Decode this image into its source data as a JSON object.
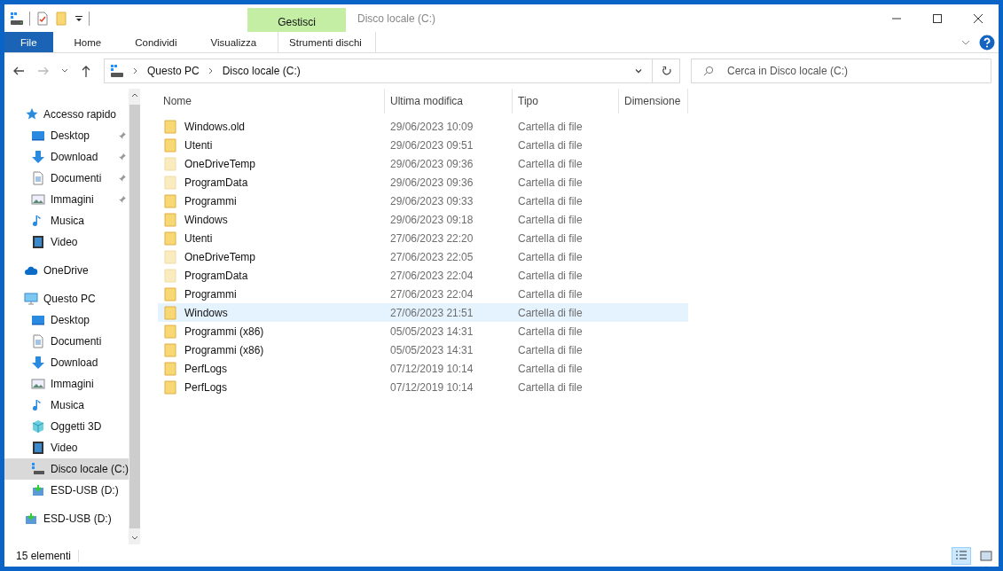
{
  "window": {
    "title": "Disco locale (C:)",
    "context_tab": "Gestisci"
  },
  "ribbon_tabs": [
    {
      "label": "File",
      "kind": "file",
      "selected": false
    },
    {
      "label": "Home",
      "kind": "tab",
      "selected": false
    },
    {
      "label": "Condividi",
      "kind": "tab",
      "selected": false
    },
    {
      "label": "Visualizza",
      "kind": "tab",
      "selected": false
    },
    {
      "label": "Strumenti dischi",
      "kind": "context",
      "selected": false
    }
  ],
  "address": {
    "path": [
      "Questo PC",
      "Disco locale (C:)"
    ]
  },
  "search": {
    "placeholder": "Cerca in Disco locale (C:)"
  },
  "sidebar": {
    "items": [
      {
        "label": "Accesso rapido",
        "kind": "star",
        "selected": false,
        "children": [
          {
            "label": "Desktop",
            "kind": "desktop",
            "pinned": true,
            "selected": false
          },
          {
            "label": "Download",
            "kind": "download",
            "pinned": true,
            "selected": false
          },
          {
            "label": "Documenti",
            "kind": "document",
            "pinned": true,
            "selected": false
          },
          {
            "label": "Immagini",
            "kind": "image",
            "pinned": true,
            "selected": false
          },
          {
            "label": "Musica",
            "kind": "music",
            "pinned": false,
            "selected": false
          },
          {
            "label": "Video",
            "kind": "video",
            "pinned": false,
            "selected": false
          }
        ]
      },
      {
        "label": "OneDrive",
        "kind": "cloud",
        "selected": false
      },
      {
        "label": "Questo PC",
        "kind": "pc",
        "selected": false,
        "children": [
          {
            "label": "Desktop",
            "kind": "desktop",
            "pinned": false,
            "selected": false
          },
          {
            "label": "Documenti",
            "kind": "document",
            "pinned": false,
            "selected": false
          },
          {
            "label": "Download",
            "kind": "download",
            "pinned": false,
            "selected": false
          },
          {
            "label": "Immagini",
            "kind": "image",
            "pinned": false,
            "selected": false
          },
          {
            "label": "Musica",
            "kind": "music",
            "pinned": false,
            "selected": false
          },
          {
            "label": "Oggetti 3D",
            "kind": "cube",
            "pinned": false,
            "selected": false
          },
          {
            "label": "Video",
            "kind": "video",
            "pinned": false,
            "selected": false
          },
          {
            "label": "Disco locale (C:)",
            "kind": "drive",
            "pinned": false,
            "selected": true
          },
          {
            "label": "ESD-USB (D:)",
            "kind": "usb",
            "pinned": false,
            "selected": false
          }
        ]
      },
      {
        "label": "ESD-USB (D:)",
        "kind": "usb",
        "selected": false
      }
    ]
  },
  "table": {
    "columns": [
      "Nome",
      "Ultima modifica",
      "Tipo",
      "Dimensione"
    ],
    "rows": [
      {
        "name": "Windows.old",
        "modified": "29/06/2023 10:09",
        "type": "Cartella di file",
        "hidden": false,
        "selected": false
      },
      {
        "name": "Utenti",
        "modified": "29/06/2023 09:51",
        "type": "Cartella di file",
        "hidden": false,
        "selected": false
      },
      {
        "name": "OneDriveTemp",
        "modified": "29/06/2023 09:36",
        "type": "Cartella di file",
        "hidden": true,
        "selected": false
      },
      {
        "name": "ProgramData",
        "modified": "29/06/2023 09:36",
        "type": "Cartella di file",
        "hidden": true,
        "selected": false
      },
      {
        "name": "Programmi",
        "modified": "29/06/2023 09:33",
        "type": "Cartella di file",
        "hidden": false,
        "selected": false
      },
      {
        "name": "Windows",
        "modified": "29/06/2023 09:18",
        "type": "Cartella di file",
        "hidden": false,
        "selected": false
      },
      {
        "name": "Utenti",
        "modified": "27/06/2023 22:20",
        "type": "Cartella di file",
        "hidden": false,
        "selected": false
      },
      {
        "name": "OneDriveTemp",
        "modified": "27/06/2023 22:05",
        "type": "Cartella di file",
        "hidden": true,
        "selected": false
      },
      {
        "name": "ProgramData",
        "modified": "27/06/2023 22:04",
        "type": "Cartella di file",
        "hidden": true,
        "selected": false
      },
      {
        "name": "Programmi",
        "modified": "27/06/2023 22:04",
        "type": "Cartella di file",
        "hidden": false,
        "selected": false
      },
      {
        "name": "Windows",
        "modified": "27/06/2023 21:51",
        "type": "Cartella di file",
        "hidden": false,
        "selected": true
      },
      {
        "name": "Programmi (x86)",
        "modified": "05/05/2023 14:31",
        "type": "Cartella di file",
        "hidden": false,
        "selected": false
      },
      {
        "name": "Programmi (x86)",
        "modified": "05/05/2023 14:31",
        "type": "Cartella di file",
        "hidden": false,
        "selected": false
      },
      {
        "name": "PerfLogs",
        "modified": "07/12/2019 10:14",
        "type": "Cartella di file",
        "hidden": false,
        "selected": false
      },
      {
        "name": "PerfLogs",
        "modified": "07/12/2019 10:14",
        "type": "Cartella di file",
        "hidden": false,
        "selected": false
      }
    ]
  },
  "status_bar": {
    "count": "15 elementi"
  }
}
